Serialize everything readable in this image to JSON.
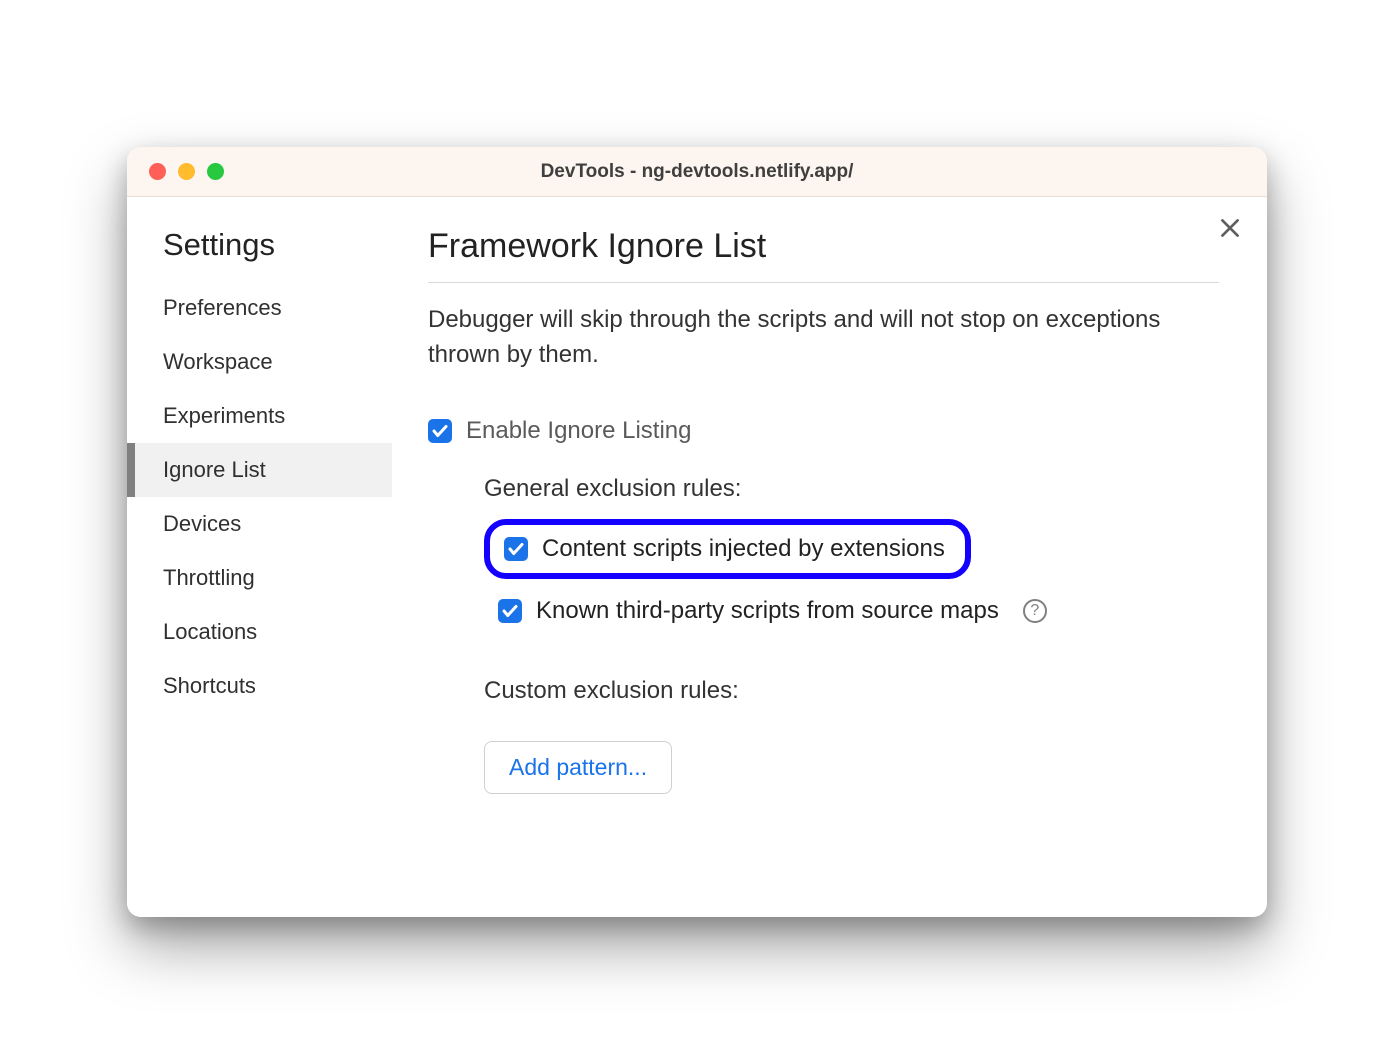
{
  "window": {
    "title": "DevTools - ng-devtools.netlify.app/"
  },
  "sidebar": {
    "title": "Settings",
    "items": [
      {
        "label": "Preferences",
        "active": false
      },
      {
        "label": "Workspace",
        "active": false
      },
      {
        "label": "Experiments",
        "active": false
      },
      {
        "label": "Ignore List",
        "active": true
      },
      {
        "label": "Devices",
        "active": false
      },
      {
        "label": "Throttling",
        "active": false
      },
      {
        "label": "Locations",
        "active": false
      },
      {
        "label": "Shortcuts",
        "active": false
      }
    ]
  },
  "content": {
    "title": "Framework Ignore List",
    "description": "Debugger will skip through the scripts and will not stop on exceptions thrown by them.",
    "enable_label": "Enable Ignore Listing",
    "enable_checked": true,
    "general_label": "General exclusion rules:",
    "rules": [
      {
        "label": "Content scripts injected by extensions",
        "checked": true,
        "highlighted": true,
        "help": false
      },
      {
        "label": "Known third-party scripts from source maps",
        "checked": true,
        "highlighted": false,
        "help": true
      }
    ],
    "custom_label": "Custom exclusion rules:",
    "add_pattern_label": "Add pattern..."
  },
  "colors": {
    "accent": "#1a73e8",
    "highlight_border": "#1400ff"
  }
}
